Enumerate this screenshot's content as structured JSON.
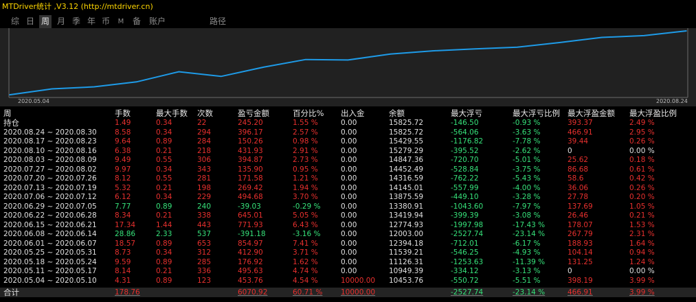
{
  "window": {
    "title": "MTDriver统计 ,V3.12 (http://mtdriver.cn)"
  },
  "tabs": [
    {
      "label": "综",
      "active": false
    },
    {
      "label": "日",
      "active": false
    },
    {
      "label": "周",
      "active": true
    },
    {
      "label": "月",
      "active": false
    },
    {
      "label": "季",
      "active": false
    },
    {
      "label": "年",
      "active": false
    },
    {
      "label": "币",
      "active": false
    },
    {
      "label": "M",
      "active": false
    },
    {
      "label": "备",
      "active": false
    },
    {
      "label": "账户",
      "active": false
    },
    {
      "label": "路径",
      "active": false
    }
  ],
  "chart_data": {
    "type": "line",
    "x_start_label": "2020.05.04",
    "x_end_label": "2020.08.24",
    "line_color": "#1e9be8",
    "x": [
      "2020.05.04",
      "2020.05.11",
      "2020.05.18",
      "2020.05.25",
      "2020.06.01",
      "2020.06.08",
      "2020.06.15",
      "2020.06.22",
      "2020.06.29",
      "2020.07.06",
      "2020.07.13",
      "2020.07.20",
      "2020.07.27",
      "2020.08.03",
      "2020.08.10",
      "2020.08.17",
      "2020.08.24"
    ],
    "values": [
      10453.76,
      10949.39,
      11126.31,
      11539.21,
      12394.18,
      12003.0,
      12774.93,
      13419.94,
      13380.91,
      13875.59,
      14145.01,
      14316.59,
      14452.49,
      14847.36,
      15279.29,
      15429.55,
      15825.72
    ]
  },
  "table": {
    "headers": [
      "周",
      "手数",
      "最大手数",
      "次数",
      "盈亏金额",
      "百分比%",
      "出入金",
      "余额",
      "最大浮亏",
      "最大浮亏比例",
      "最大浮盈金额",
      "最大浮盈比例"
    ],
    "open": {
      "label": "持仓",
      "lots": "1.49",
      "maxlots": "0.34",
      "count": "22",
      "pl": "245.20",
      "pct": "1.55 %",
      "flow": "0.00",
      "bal": "15825.72",
      "fl": "-146.50",
      "flp": "-0.93 %",
      "fp": "393.37",
      "fpp": "2.49 %"
    },
    "rows": [
      {
        "period": "2020.08.24 ~ 2020.08.30",
        "lots": "8.58",
        "maxlots": "0.34",
        "count": "294",
        "pl": "396.17",
        "pct": "2.57 %",
        "flow": "0.00",
        "bal": "15825.72",
        "fl": "-564.06",
        "flp": "-3.63 %",
        "fp": "466.91",
        "fpp": "2.95 %",
        "sign": "pos"
      },
      {
        "period": "2020.08.17 ~ 2020.08.23",
        "lots": "9.64",
        "maxlots": "0.89",
        "count": "284",
        "pl": "150.26",
        "pct": "0.98 %",
        "flow": "0.00",
        "bal": "15429.55",
        "fl": "-1176.82",
        "flp": "-7.78 %",
        "fp": "39.44",
        "fpp": "0.26 %",
        "sign": "pos"
      },
      {
        "period": "2020.08.10 ~ 2020.08.16",
        "lots": "6.38",
        "maxlots": "0.21",
        "count": "218",
        "pl": "431.93",
        "pct": "2.91 %",
        "flow": "0.00",
        "bal": "15279.29",
        "fl": "-395.52",
        "flp": "-2.62 %",
        "fp": "0",
        "fpp": "0.00 %",
        "sign": "pos",
        "fp_zero": true
      },
      {
        "period": "2020.08.03 ~ 2020.08.09",
        "lots": "9.49",
        "maxlots": "0.55",
        "count": "306",
        "pl": "394.87",
        "pct": "2.73 %",
        "flow": "0.00",
        "bal": "14847.36",
        "fl": "-720.70",
        "flp": "-5.01 %",
        "fp": "25.62",
        "fpp": "0.18 %",
        "sign": "pos"
      },
      {
        "period": "2020.07.27 ~ 2020.08.02",
        "lots": "9.97",
        "maxlots": "0.34",
        "count": "343",
        "pl": "135.90",
        "pct": "0.95 %",
        "flow": "0.00",
        "bal": "14452.49",
        "fl": "-528.84",
        "flp": "-3.75 %",
        "fp": "86.68",
        "fpp": "0.61 %",
        "sign": "pos"
      },
      {
        "period": "2020.07.20 ~ 2020.07.26",
        "lots": "8.12",
        "maxlots": "0.55",
        "count": "281",
        "pl": "171.58",
        "pct": "1.21 %",
        "flow": "0.00",
        "bal": "14316.59",
        "fl": "-762.22",
        "flp": "-5.43 %",
        "fp": "58.6",
        "fpp": "0.42 %",
        "sign": "pos"
      },
      {
        "period": "2020.07.13 ~ 2020.07.19",
        "lots": "5.32",
        "maxlots": "0.21",
        "count": "198",
        "pl": "269.42",
        "pct": "1.94 %",
        "flow": "0.00",
        "bal": "14145.01",
        "fl": "-557.99",
        "flp": "-4.00 %",
        "fp": "36.06",
        "fpp": "0.26 %",
        "sign": "pos"
      },
      {
        "period": "2020.07.06 ~ 2020.07.12",
        "lots": "6.12",
        "maxlots": "0.34",
        "count": "229",
        "pl": "494.68",
        "pct": "3.70 %",
        "flow": "0.00",
        "bal": "13875.59",
        "fl": "-449.10",
        "flp": "-3.28 %",
        "fp": "27.78",
        "fpp": "0.20 %",
        "sign": "pos"
      },
      {
        "period": "2020.06.29 ~ 2020.07.05",
        "lots": "7.77",
        "maxlots": "0.89",
        "count": "240",
        "pl": "-39.03",
        "pct": "-0.29 %",
        "flow": "0.00",
        "bal": "13380.91",
        "fl": "-1043.60",
        "flp": "-7.97 %",
        "fp": "137.69",
        "fpp": "1.05 %",
        "sign": "neg"
      },
      {
        "period": "2020.06.22 ~ 2020.06.28",
        "lots": "8.34",
        "maxlots": "0.21",
        "count": "338",
        "pl": "645.01",
        "pct": "5.05 %",
        "flow": "0.00",
        "bal": "13419.94",
        "fl": "-399.39",
        "flp": "-3.08 %",
        "fp": "26.46",
        "fpp": "0.21 %",
        "sign": "pos"
      },
      {
        "period": "2020.06.15 ~ 2020.06.21",
        "lots": "17.34",
        "maxlots": "1.44",
        "count": "443",
        "pl": "771.93",
        "pct": "6.43 %",
        "flow": "0.00",
        "bal": "12774.93",
        "fl": "-1997.98",
        "flp": "-17.43 %",
        "fp": "178.07",
        "fpp": "1.53 %",
        "sign": "pos"
      },
      {
        "period": "2020.06.08 ~ 2020.06.14",
        "lots": "28.86",
        "maxlots": "2.33",
        "count": "537",
        "pl": "-391.18",
        "pct": "-3.16 %",
        "flow": "0.00",
        "bal": "12003.00",
        "fl": "-2527.74",
        "flp": "-23.14 %",
        "fp": "267.79",
        "fpp": "2.31 %",
        "sign": "neg"
      },
      {
        "period": "2020.06.01 ~ 2020.06.07",
        "lots": "18.57",
        "maxlots": "0.89",
        "count": "653",
        "pl": "854.97",
        "pct": "7.41 %",
        "flow": "0.00",
        "bal": "12394.18",
        "fl": "-712.01",
        "flp": "-6.17 %",
        "fp": "188.93",
        "fpp": "1.64 %",
        "sign": "pos"
      },
      {
        "period": "2020.05.25 ~ 2020.05.31",
        "lots": "8.73",
        "maxlots": "0.34",
        "count": "312",
        "pl": "412.90",
        "pct": "3.71 %",
        "flow": "0.00",
        "bal": "11539.21",
        "fl": "-546.25",
        "flp": "-4.93 %",
        "fp": "104.14",
        "fpp": "0.94 %",
        "sign": "pos"
      },
      {
        "period": "2020.05.18 ~ 2020.05.24",
        "lots": "9.59",
        "maxlots": "0.89",
        "count": "285",
        "pl": "176.92",
        "pct": "1.62 %",
        "flow": "0.00",
        "bal": "11126.31",
        "fl": "-1253.63",
        "flp": "-11.39 %",
        "fp": "131.25",
        "fpp": "1.24 %",
        "sign": "pos"
      },
      {
        "period": "2020.05.11 ~ 2020.05.17",
        "lots": "8.14",
        "maxlots": "0.21",
        "count": "336",
        "pl": "495.63",
        "pct": "4.74 %",
        "flow": "0.00",
        "bal": "10949.39",
        "fl": "-334.12",
        "flp": "-3.13 %",
        "fp": "0",
        "fpp": "0.00 %",
        "sign": "pos",
        "fp_zero": true
      },
      {
        "period": "2020.05.04 ~ 2020.05.10",
        "lots": "4.31",
        "maxlots": "0.89",
        "count": "123",
        "pl": "453.76",
        "pct": "4.54 %",
        "flow": "10000.00",
        "bal": "10453.76",
        "fl": "-550.72",
        "flp": "-5.51 %",
        "fp": "398.19",
        "fpp": "3.99 %",
        "sign": "pos",
        "flow_red": true
      }
    ],
    "total": {
      "label": "合计",
      "lots": "178.76",
      "pl": "6070.92",
      "pct": "60.71 %",
      "flow": "10000.00",
      "fl": "-2527.74",
      "flp": "-23.14 %",
      "fp": "466.91",
      "fpp": "3.99 %"
    }
  },
  "colors": {
    "positive": "#e8302e",
    "negative": "#36e27a",
    "neutral": "#e0e0e0"
  }
}
